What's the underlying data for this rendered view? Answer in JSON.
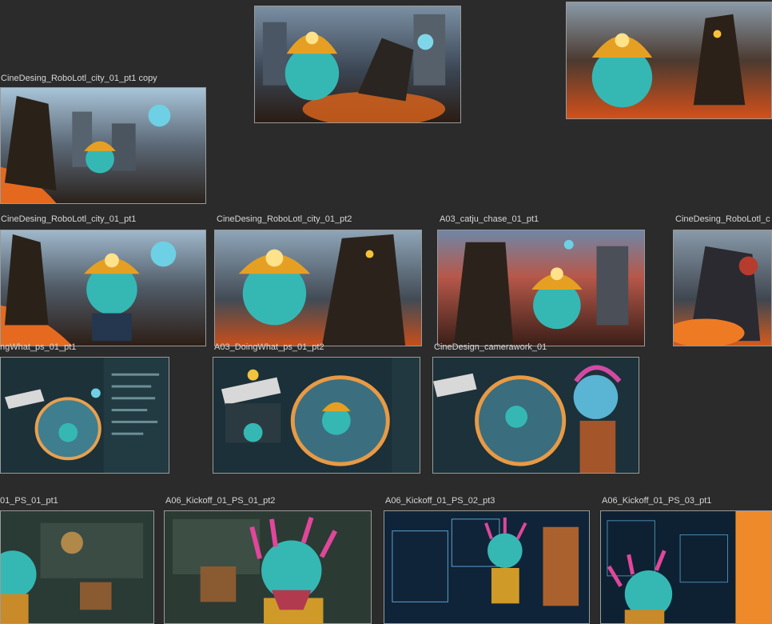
{
  "tiles": [
    {
      "label": "",
      "scene": "city"
    },
    {
      "label": "",
      "scene": "catju"
    },
    {
      "label": "CineDesing_RoboLotl_city_01_pt1 copy",
      "scene": "city"
    },
    {
      "label": "CineDesing_RoboLotl_city_01_pt1",
      "scene": "city"
    },
    {
      "label": "CineDesing_RoboLotl_city_01_pt2",
      "scene": "city"
    },
    {
      "label": "A03_catju_chase_01_pt1",
      "scene": "catju"
    },
    {
      "label": "CineDesing_RoboLotl_c",
      "scene": "fire"
    },
    {
      "label": "ngWhat_ps_01_pt1",
      "scene": "clapper"
    },
    {
      "label": "A03_DoingWhat_ps_01_pt2",
      "scene": "clapper"
    },
    {
      "label": "CineDesign_camerawork_01",
      "scene": "clapper"
    },
    {
      "label": "01_PS_01_pt1",
      "scene": "room"
    },
    {
      "label": "A06_Kickoff_01_PS_01_pt2",
      "scene": "room"
    },
    {
      "label": "A06_Kickoff_01_PS_02_pt3",
      "scene": "blue"
    },
    {
      "label": "A06_Kickoff_01_PS_03_pt1",
      "scene": "blue"
    }
  ]
}
